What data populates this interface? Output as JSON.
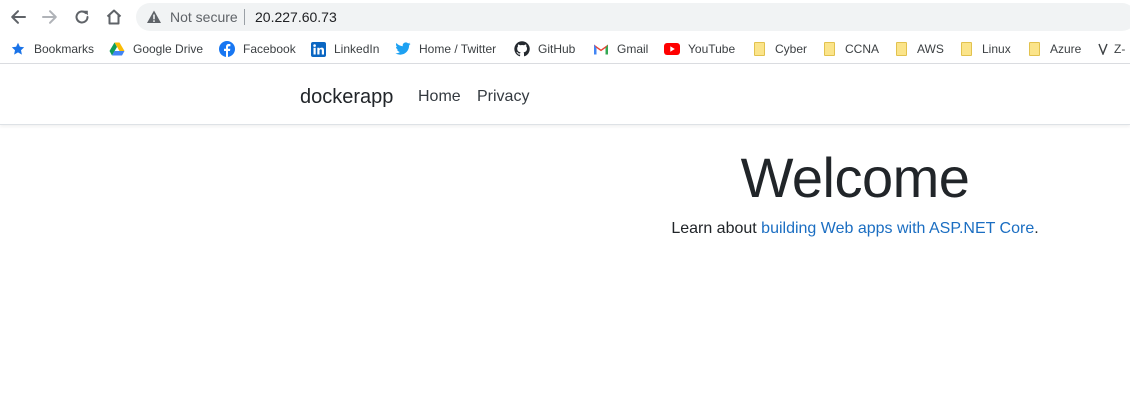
{
  "browser": {
    "security_label": "Not secure",
    "url": "20.227.60.73"
  },
  "bookmarks": [
    {
      "label": "Bookmarks",
      "icon": "star-icon"
    },
    {
      "label": "Google Drive",
      "icon": "google-drive-icon"
    },
    {
      "label": "Facebook",
      "icon": "facebook-icon"
    },
    {
      "label": "LinkedIn",
      "icon": "linkedin-icon"
    },
    {
      "label": "Home / Twitter",
      "icon": "twitter-icon"
    },
    {
      "label": "GitHub",
      "icon": "github-icon"
    },
    {
      "label": "Gmail",
      "icon": "gmail-icon"
    },
    {
      "label": "YouTube",
      "icon": "youtube-icon"
    },
    {
      "label": "Cyber",
      "icon": "folder-icon"
    },
    {
      "label": "CCNA",
      "icon": "folder-icon"
    },
    {
      "label": "AWS",
      "icon": "folder-icon"
    },
    {
      "label": "Linux",
      "icon": "folder-icon"
    },
    {
      "label": "Azure",
      "icon": "folder-icon"
    },
    {
      "label": "Z-",
      "icon": "v-icon"
    }
  ],
  "site": {
    "brand": "dockerapp",
    "nav": [
      {
        "label": "Home"
      },
      {
        "label": "Privacy"
      }
    ],
    "hero": {
      "title": "Welcome",
      "text_prefix": "Learn about ",
      "link_text": "building Web apps with ASP.NET Core",
      "text_suffix": "."
    }
  },
  "colors": {
    "link": "#1b6ec2",
    "folder": "#fbe48a",
    "omnibox_bg": "#f1f3f4"
  }
}
